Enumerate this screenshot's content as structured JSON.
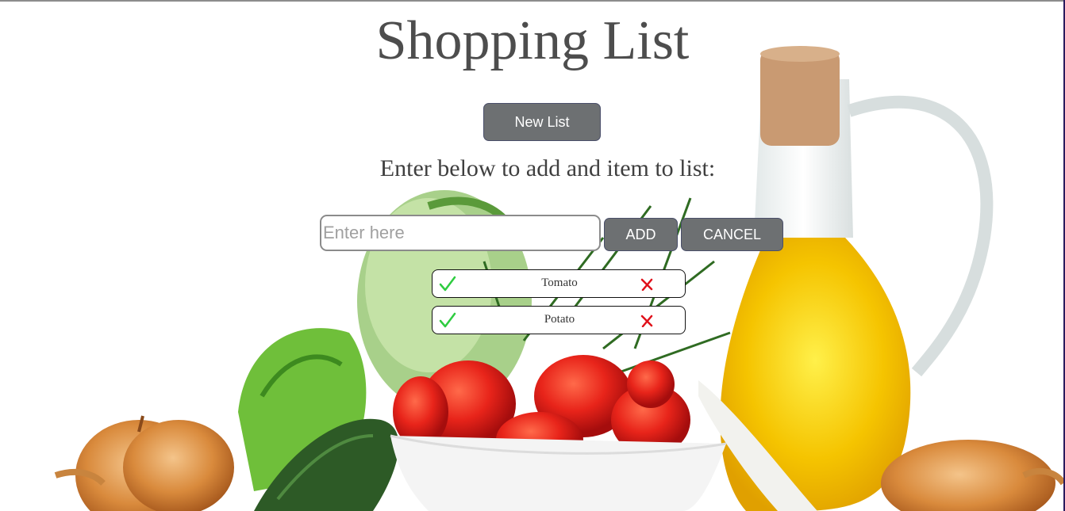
{
  "page": {
    "title": "Shopping List",
    "new_list_label": "New List",
    "instruction": "Enter below to add and item to list:"
  },
  "form": {
    "input_placeholder": "Enter here",
    "input_value": "",
    "add_label": "ADD",
    "cancel_label": "CANCEL"
  },
  "items": [
    {
      "label": "Tomato",
      "check_icon": "check-icon",
      "remove_icon": "x-icon"
    },
    {
      "label": "Potato",
      "check_icon": "check-icon",
      "remove_icon": "x-icon"
    }
  ],
  "colors": {
    "button_bg": "#6d7072",
    "title_text": "#4d4d4d",
    "check": "#2ecc40",
    "remove": "#e0101a"
  }
}
